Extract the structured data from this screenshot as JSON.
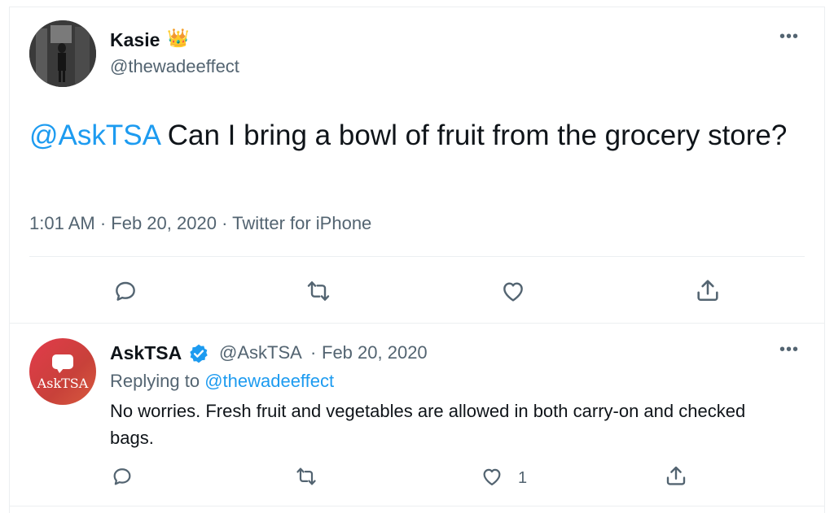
{
  "colors": {
    "accent": "#1d9bf0",
    "secondary_text": "#536471",
    "primary_text": "#0f1419",
    "avatar_reply": "#d2443f"
  },
  "main_tweet": {
    "author_name": "Kasie",
    "author_emoji": "👑",
    "author_handle": "@thewadeeffect",
    "more_label": "•••",
    "mention": "@AskTSA",
    "text": " Can I bring a bowl of fruit from the grocery store?",
    "time": "1:01 AM",
    "sep1": " · ",
    "date": "Feb 20, 2020",
    "sep2": " · ",
    "source": "Twitter for iPhone",
    "actions": [
      "reply-icon",
      "retweet-icon",
      "like-icon",
      "share-icon"
    ]
  },
  "reply_tweet": {
    "avatar_label": "AskTSA",
    "author_name": "AskTSA",
    "verified_icon": "verified-badge-icon",
    "author_handle": "@AskTSA",
    "dot": "·",
    "date": "Feb 20, 2020",
    "more_label": "•••",
    "replying_prefix": "Replying to ",
    "replying_handle": "@thewadeeffect",
    "text": "No worries. Fresh fruit and vegetables are allowed in both carry-on and checked bags.",
    "like_count": "1",
    "actions": [
      "reply-icon",
      "retweet-icon",
      "like-icon",
      "share-icon"
    ]
  }
}
